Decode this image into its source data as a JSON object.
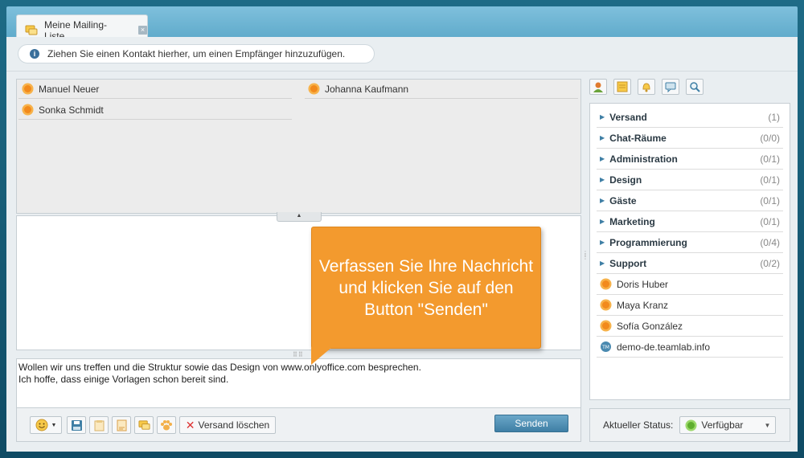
{
  "tab": {
    "title": "Meine Mailing-Liste",
    "close_glyph": "×"
  },
  "hint": {
    "text": "Ziehen Sie einen Kontakt hierher, um einen Empfänger hinzuzufügen."
  },
  "recipients": [
    {
      "name": "Manuel Neuer"
    },
    {
      "name": "Johanna Kaufmann"
    },
    {
      "name": "Sonka Schmidt"
    }
  ],
  "compose": {
    "line1": "Wollen wir uns treffen und die Struktur sowie das Design von www.onlyoffice.com besprechen.",
    "line2": "Ich hoffe, dass einige Vorlagen schon bereit sind."
  },
  "toolbar": {
    "clear_label": "Versand löschen",
    "send_label": "Senden",
    "icons": [
      "smiley-icon",
      "save-icon",
      "template-icon",
      "history-icon",
      "chat-icon",
      "paw-icon"
    ]
  },
  "callout": {
    "text": "Verfassen Sie Ihre Nachricht und klicken Sie auf den Button \"Senden\""
  },
  "right_tools": [
    "contacts-icon",
    "rooms-icon",
    "notifications-icon",
    "chat-icon",
    "search-icon"
  ],
  "groups": [
    {
      "name": "Versand",
      "count": "(1)"
    },
    {
      "name": "Chat-Räume",
      "count": "(0/0)"
    },
    {
      "name": "Administration",
      "count": "(0/1)"
    },
    {
      "name": "Design",
      "count": "(0/1)"
    },
    {
      "name": "Gäste",
      "count": "(0/1)"
    },
    {
      "name": "Marketing",
      "count": "(0/1)"
    },
    {
      "name": "Programmierung",
      "count": "(0/4)"
    },
    {
      "name": "Support",
      "count": "(0/2)"
    }
  ],
  "people": [
    {
      "name": "Doris Huber"
    },
    {
      "name": "Maya Kranz"
    },
    {
      "name": "Sofía González"
    },
    {
      "name": "demo-de.teamlab.info"
    }
  ],
  "status": {
    "label": "Aktueller Status:",
    "value": "Verfügbar"
  },
  "colors": {
    "accent": "#f39a2e",
    "header": "#6aaecd",
    "send": "#4a8ab0",
    "online": "#7ac943"
  }
}
